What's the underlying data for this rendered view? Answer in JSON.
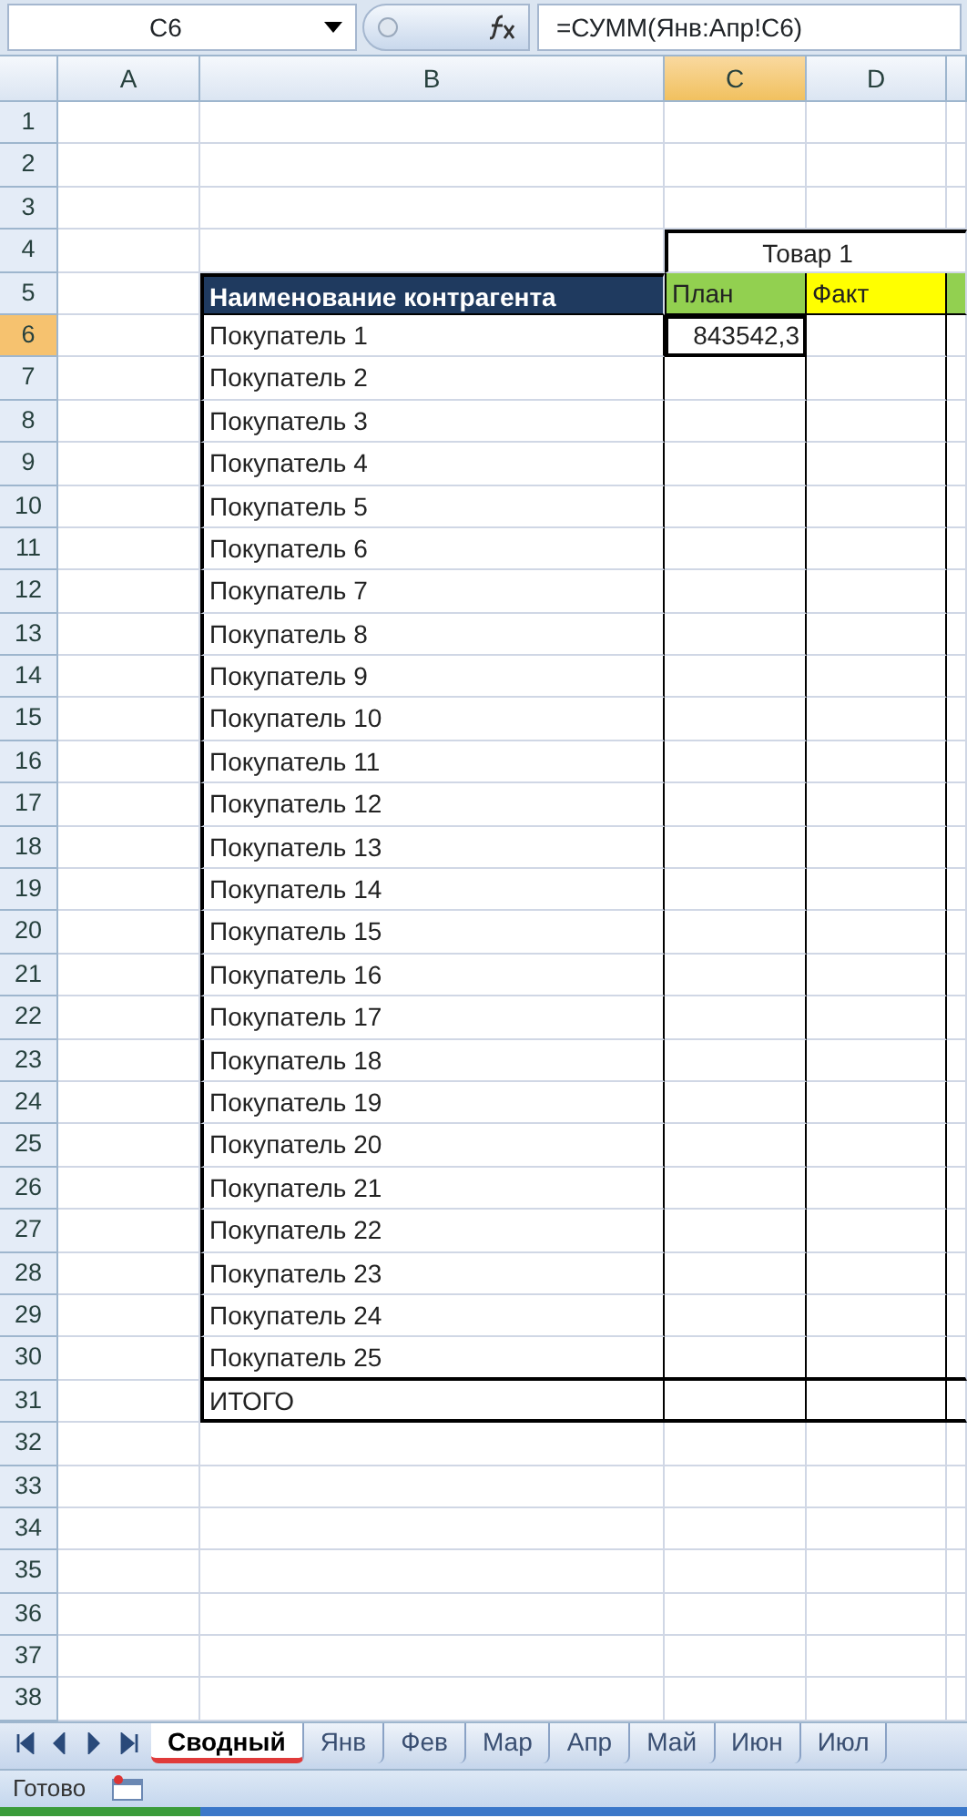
{
  "name_box": "C6",
  "formula": "=СУММ(Янв:Апр!C6)",
  "columns": [
    {
      "label": "A",
      "selected": false
    },
    {
      "label": "B",
      "selected": false
    },
    {
      "label": "C",
      "selected": true
    },
    {
      "label": "D",
      "selected": false
    }
  ],
  "rows": [
    {
      "number": "1",
      "selected": false,
      "kind": "empty"
    },
    {
      "number": "2",
      "selected": false,
      "kind": "empty"
    },
    {
      "number": "3",
      "selected": false,
      "kind": "empty"
    },
    {
      "number": "4",
      "selected": false,
      "kind": "group-header",
      "c": {
        "text": "Товар 1"
      }
    },
    {
      "number": "5",
      "selected": false,
      "kind": "header",
      "b": {
        "text": "Наименование контрагента"
      },
      "c": {
        "text": "План"
      },
      "d": {
        "text": "Факт"
      }
    },
    {
      "number": "6",
      "selected": true,
      "kind": "data",
      "b": {
        "text": "Покупатель 1"
      },
      "c": {
        "text": "843542,3",
        "active": true
      }
    },
    {
      "number": "7",
      "selected": false,
      "kind": "data",
      "b": {
        "text": "Покупатель 2"
      }
    },
    {
      "number": "8",
      "selected": false,
      "kind": "data",
      "b": {
        "text": "Покупатель 3"
      }
    },
    {
      "number": "9",
      "selected": false,
      "kind": "data",
      "b": {
        "text": "Покупатель 4"
      }
    },
    {
      "number": "10",
      "selected": false,
      "kind": "data",
      "b": {
        "text": "Покупатель 5"
      }
    },
    {
      "number": "11",
      "selected": false,
      "kind": "data",
      "b": {
        "text": "Покупатель 6"
      }
    },
    {
      "number": "12",
      "selected": false,
      "kind": "data",
      "b": {
        "text": "Покупатель 7"
      }
    },
    {
      "number": "13",
      "selected": false,
      "kind": "data",
      "b": {
        "text": "Покупатель 8"
      }
    },
    {
      "number": "14",
      "selected": false,
      "kind": "data",
      "b": {
        "text": "Покупатель 9"
      }
    },
    {
      "number": "15",
      "selected": false,
      "kind": "data",
      "b": {
        "text": "Покупатель 10"
      }
    },
    {
      "number": "16",
      "selected": false,
      "kind": "data",
      "b": {
        "text": "Покупатель 11"
      }
    },
    {
      "number": "17",
      "selected": false,
      "kind": "data",
      "b": {
        "text": "Покупатель 12"
      }
    },
    {
      "number": "18",
      "selected": false,
      "kind": "data",
      "b": {
        "text": "Покупатель 13"
      }
    },
    {
      "number": "19",
      "selected": false,
      "kind": "data",
      "b": {
        "text": "Покупатель 14"
      }
    },
    {
      "number": "20",
      "selected": false,
      "kind": "data",
      "b": {
        "text": "Покупатель 15"
      }
    },
    {
      "number": "21",
      "selected": false,
      "kind": "data",
      "b": {
        "text": "Покупатель 16"
      }
    },
    {
      "number": "22",
      "selected": false,
      "kind": "data",
      "b": {
        "text": "Покупатель 17"
      }
    },
    {
      "number": "23",
      "selected": false,
      "kind": "data",
      "b": {
        "text": "Покупатель 18"
      }
    },
    {
      "number": "24",
      "selected": false,
      "kind": "data",
      "b": {
        "text": "Покупатель 19"
      }
    },
    {
      "number": "25",
      "selected": false,
      "kind": "data",
      "b": {
        "text": "Покупатель 20"
      }
    },
    {
      "number": "26",
      "selected": false,
      "kind": "data",
      "b": {
        "text": "Покупатель 21"
      }
    },
    {
      "number": "27",
      "selected": false,
      "kind": "data",
      "b": {
        "text": "Покупатель 22"
      }
    },
    {
      "number": "28",
      "selected": false,
      "kind": "data",
      "b": {
        "text": "Покупатель 23"
      }
    },
    {
      "number": "29",
      "selected": false,
      "kind": "data",
      "b": {
        "text": "Покупатель 24"
      }
    },
    {
      "number": "30",
      "selected": false,
      "kind": "data",
      "b": {
        "text": "Покупатель 25"
      }
    },
    {
      "number": "31",
      "selected": false,
      "kind": "total",
      "b": {
        "text": "ИТОГО"
      }
    },
    {
      "number": "32",
      "selected": false,
      "kind": "empty"
    },
    {
      "number": "33",
      "selected": false,
      "kind": "empty"
    },
    {
      "number": "34",
      "selected": false,
      "kind": "empty"
    },
    {
      "number": "35",
      "selected": false,
      "kind": "empty"
    },
    {
      "number": "36",
      "selected": false,
      "kind": "empty"
    },
    {
      "number": "37",
      "selected": false,
      "kind": "empty"
    },
    {
      "number": "38",
      "selected": false,
      "kind": "empty"
    }
  ],
  "sheet_tabs": [
    {
      "label": "Сводный",
      "selected": true
    },
    {
      "label": "Янв",
      "selected": false
    },
    {
      "label": "Фев",
      "selected": false
    },
    {
      "label": "Мар",
      "selected": false
    },
    {
      "label": "Апр",
      "selected": false
    },
    {
      "label": "Май",
      "selected": false
    },
    {
      "label": "Июн",
      "selected": false
    },
    {
      "label": "Июл",
      "selected": false
    }
  ],
  "status": "Готово"
}
